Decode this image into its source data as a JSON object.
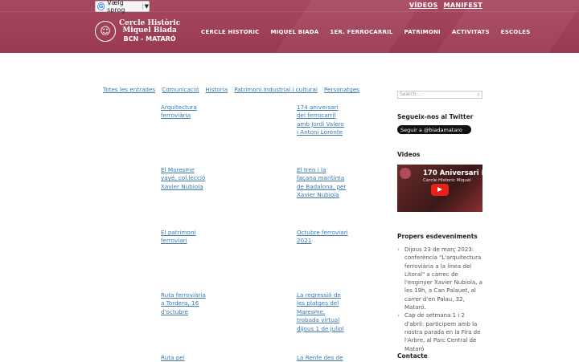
{
  "translate": {
    "label": "Vælg sprog",
    "arrow": "▼"
  },
  "toplinks": [
    "VÍDEOS",
    "MANIFEST"
  ],
  "logo": {
    "line1": "Cercle Històric",
    "line2": "Miquel Biada",
    "line3": "BCN - MATARÓ"
  },
  "nav": [
    "CERCLE HISTORIC",
    "MIQUEL BIADA",
    "1ER. FERROCARRIL",
    "PATRIMONI",
    "ACTIVITATS",
    "ESCOLES"
  ],
  "filters": [
    "Totes les entrades",
    "Comunicació",
    "Historia",
    "Patrimoni industrial i cultural",
    "Personatges"
  ],
  "posts": [
    "Arquitectura ferroviària",
    "174 aniversari del ferrocarril amb Jordi Valero i Antoni Lorente",
    "El Maresme yayé, col.lecció Xavier Nubiola",
    "El tren i la façana marítima de Badalona, per Xavier Nubiola",
    "El patrimoni ferroviari",
    "Octubre ferroviari 2021",
    "Ruta ferroviària a Tordera, 16 d'octubre",
    "La regressió de les platges del Maresme, trobada virtual dijous 1 de juliol",
    "Ruta pel",
    "La Renfe des de"
  ],
  "sidebar": {
    "search_placeholder": "Search...",
    "twitter_title": "Segueix-nos al Twitter",
    "twitter_button": "Seguir a @biadamataro",
    "videos_title": "Videos",
    "video_title": "170 Aniversari F",
    "video_channel": "Cercle Historic Miquel",
    "events_title": "Propers esdeveniments",
    "events": [
      "Dijous 23 de març 2023: conferència \"L'arquitectura ferroviària a la línea del Litoral\" a càrrec de l'enginyer Xavier Nubiola, a les 19h, a Can Palauet, al carrer d'en Palau, 32, Mataró.",
      "Cap de setmana 1 i 2 d'abril: participem amb la nostra parada en la Fira de l'Arbre, al Parc Central de Mataró"
    ],
    "contact_title": "Contacte"
  }
}
